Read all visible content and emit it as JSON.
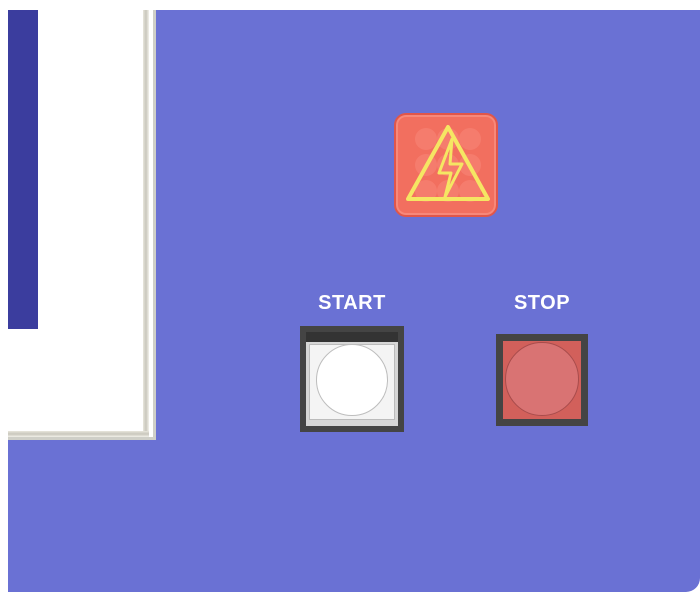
{
  "controls": {
    "start_label": "START",
    "stop_label": "STOP"
  },
  "icons": {
    "warning": "high-voltage-warning-icon"
  },
  "colors": {
    "panel": "#6a71d4",
    "left_strip": "#3b3d9e",
    "warning_lamp": "#f26f5f",
    "warning_symbol": "#f5e663",
    "stop_face": "#d97373",
    "start_face": "#ffffff"
  }
}
